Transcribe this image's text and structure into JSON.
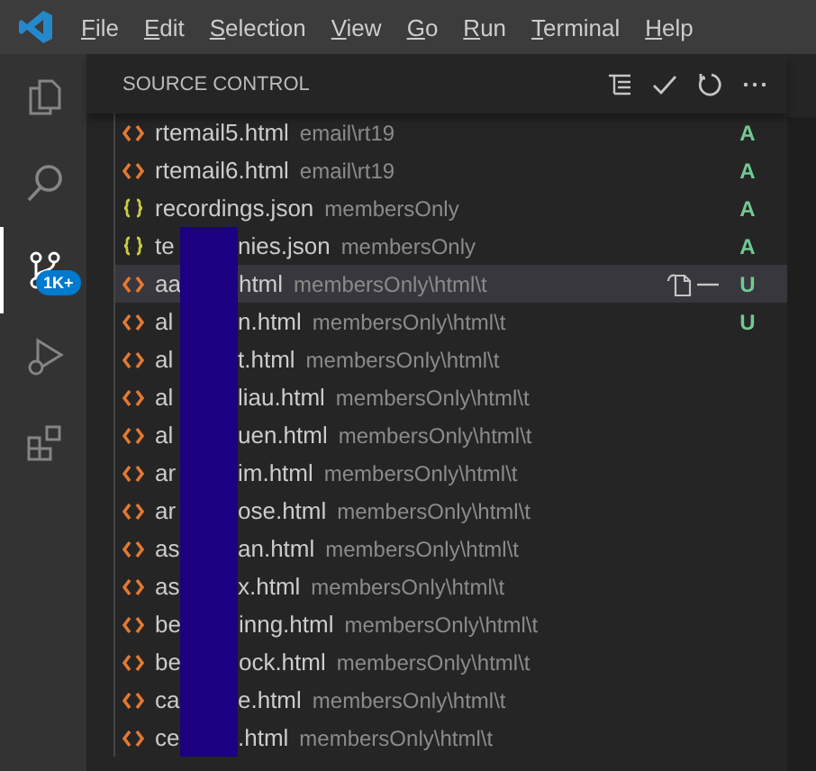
{
  "menu": [
    "File",
    "Edit",
    "Selection",
    "View",
    "Go",
    "Run",
    "Terminal",
    "Help"
  ],
  "activity_bar": [
    {
      "kind": "files",
      "selected": false
    },
    {
      "kind": "search",
      "selected": false
    },
    {
      "kind": "scm",
      "selected": true,
      "badge": "1K+"
    },
    {
      "kind": "debug",
      "selected": false
    },
    {
      "kind": "extensions",
      "selected": false
    }
  ],
  "panel": {
    "title": "SOURCE CONTROL"
  },
  "changes": [
    {
      "kind": "html",
      "name": "rtemail5.html",
      "description": "email\\rt19",
      "status": "A",
      "selected": false
    },
    {
      "kind": "html",
      "name": "rtemail6.html",
      "description": "email\\rt19",
      "status": "A",
      "selected": false
    },
    {
      "kind": "json",
      "name": "recordings.json",
      "description": "membersOnly",
      "status": "A",
      "selected": false
    },
    {
      "kind": "json",
      "name_start": "te",
      "name_end": "nies.json",
      "description": "membersOnly",
      "status": "A",
      "selected": false
    },
    {
      "kind": "html",
      "name_start": "aa",
      "name_end": "html",
      "description": "membersOnly\\html\\t",
      "status": "U",
      "selected": true
    },
    {
      "kind": "html",
      "name_start": "al",
      "name_end": "n.html",
      "description": "membersOnly\\html\\t",
      "status": "U",
      "selected": false
    },
    {
      "kind": "html",
      "name_start": "al",
      "name_end": "t.html",
      "description": "membersOnly\\html\\t",
      "selected": false
    },
    {
      "kind": "html",
      "name_start": "al",
      "name_end": "liau.html",
      "description": "membersOnly\\html\\t",
      "selected": false
    },
    {
      "kind": "html",
      "name_start": "al",
      "name_end": "uen.html",
      "description": "membersOnly\\html\\t",
      "selected": false
    },
    {
      "kind": "html",
      "name_start": "ar",
      "name_end": "im.html",
      "description": "membersOnly\\html\\t",
      "selected": false
    },
    {
      "kind": "html",
      "name_start": "ar",
      "name_end": "ose.html",
      "description": "membersOnly\\html\\t",
      "selected": false
    },
    {
      "kind": "html",
      "name_start": "as",
      "name_end": "an.html",
      "description": "membersOnly\\html\\t",
      "selected": false
    },
    {
      "kind": "html",
      "name_start": "as",
      "name_end": "x.html",
      "description": "membersOnly\\html\\t",
      "selected": false
    },
    {
      "kind": "html",
      "name_start": "be",
      "name_end": "inng.html",
      "description": "membersOnly\\html\\t",
      "selected": false
    },
    {
      "kind": "html",
      "name_start": "be",
      "name_end": "ock.html",
      "description": "membersOnly\\html\\t",
      "selected": false
    },
    {
      "kind": "html",
      "name_start": "ca",
      "name_end": "e.html",
      "description": "membersOnly\\html\\t",
      "selected": false
    },
    {
      "kind": "html",
      "name_start": "ce",
      "name_end": ".html",
      "description": "membersOnly\\html\\t",
      "selected": false
    }
  ]
}
